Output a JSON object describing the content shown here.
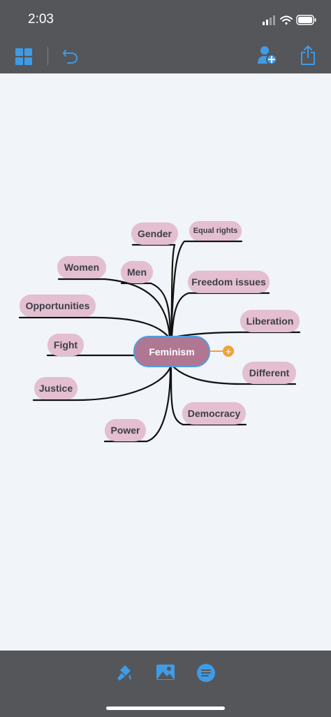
{
  "status_bar": {
    "time": "2:03"
  },
  "toolbar": {
    "left_icons": [
      "grid-icon",
      "undo-icon"
    ],
    "right_icons": [
      "add-collaborator-icon",
      "share-icon"
    ]
  },
  "mindmap": {
    "center": "Feminism",
    "branches": [
      "Gender",
      "Equal rights",
      "Women",
      "Men",
      "Freedom issues",
      "Opportunities",
      "Liberation",
      "Fight",
      "Different",
      "Justice",
      "Democracy",
      "Power"
    ]
  },
  "bottom_toolbar": {
    "icons": [
      "format-brush-icon",
      "image-icon",
      "notes-icon"
    ]
  },
  "colors": {
    "bar": "#54565a",
    "canvas": "#f1f4f8",
    "node": "#e3bfd1",
    "center": "#b07793",
    "center_border": "#4f9de0",
    "accent": "#f0a23a",
    "icon_blue": "#3f9be6"
  }
}
